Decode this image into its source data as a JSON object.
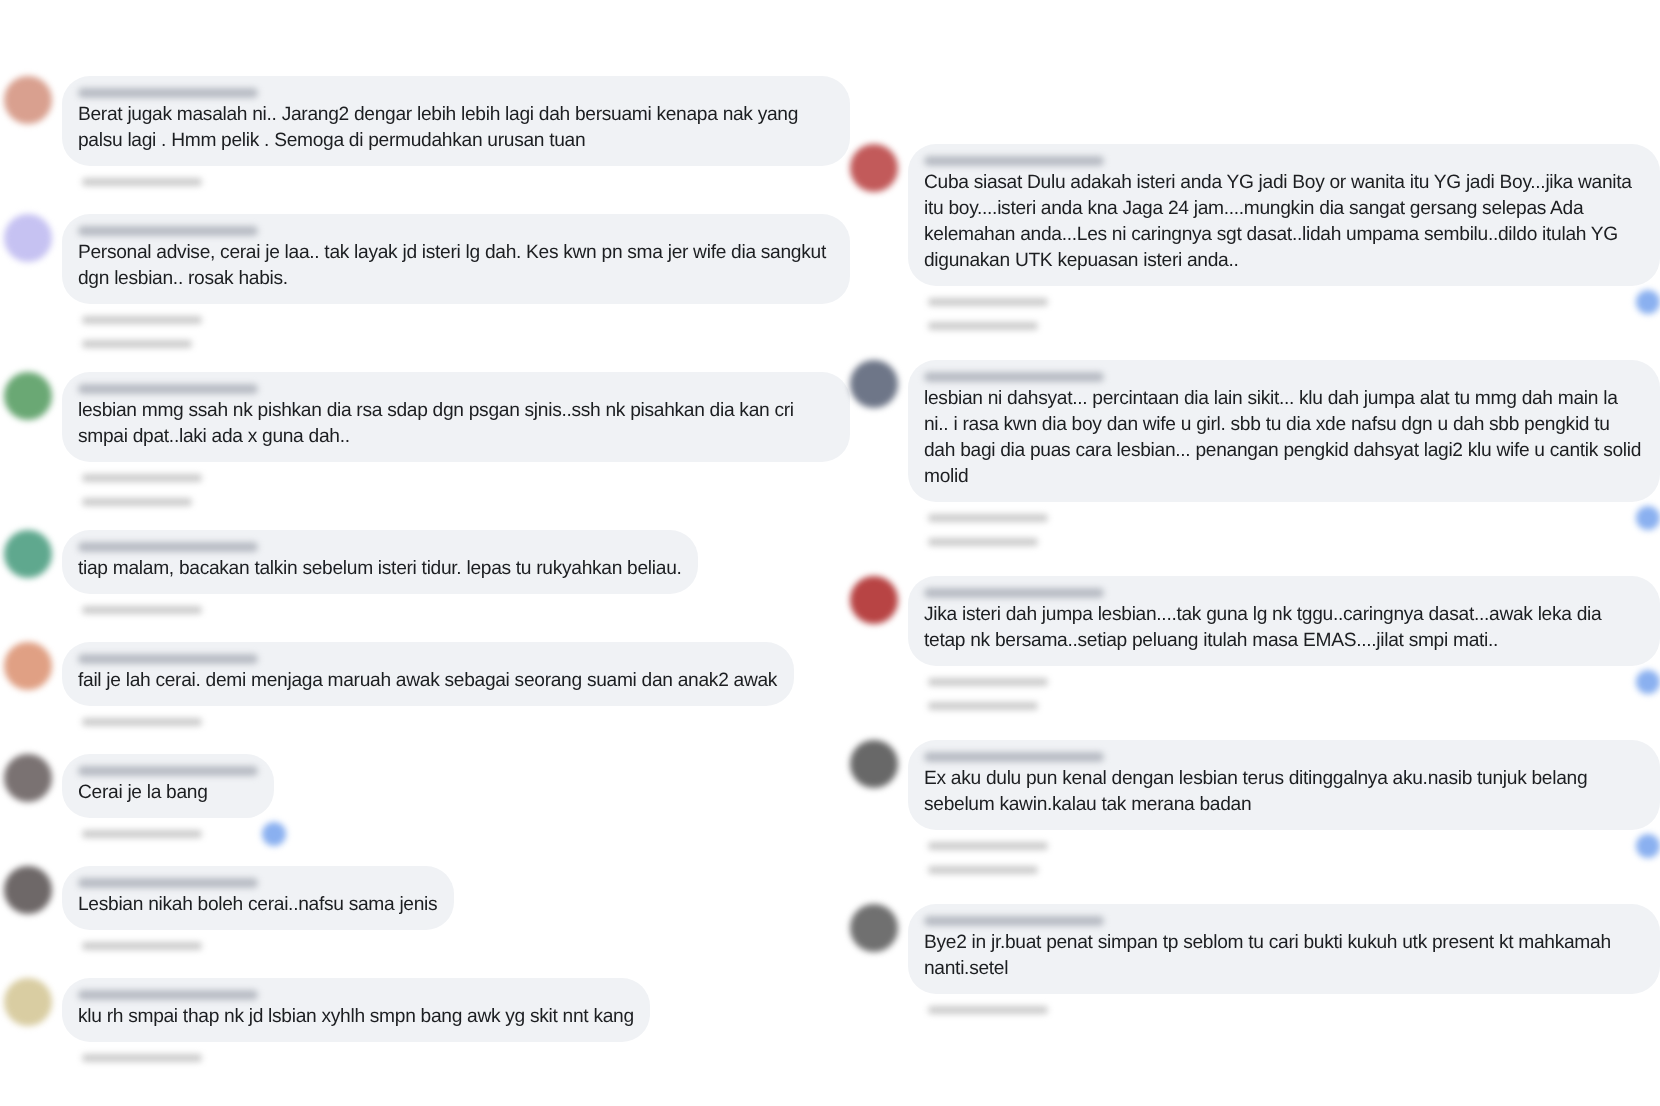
{
  "columns": [
    {
      "comments": [
        {
          "color": "#d9a08f",
          "text": "Berat jugak masalah ni.. Jarang2 dengar lebih lebih lagi dah bersuami kenapa nak yang palsu lagi . Hmm pelik . Semoga di permudahkan urusan tuan",
          "has_replies": false,
          "reacted": false
        },
        {
          "color": "#c6c2f2",
          "text": "Personal advise, cerai je laa.. tak layak jd isteri lg dah. Kes kwn pn sma jer wife dia sangkut dgn lesbian.. rosak habis.",
          "has_replies": true,
          "reacted": false
        },
        {
          "color": "#6aa874",
          "text": "lesbian mmg ssah nk pishkan dia rsa sdap dgn psgan sjnis..ssh nk pisahkan dia kan cri smpai dpat..laki ada x guna dah..",
          "has_replies": true,
          "reacted": false
        },
        {
          "color": "#5fa88e",
          "text": "tiap malam, bacakan talkin sebelum isteri tidur. lepas tu rukyahkan beliau.",
          "has_replies": false,
          "reacted": false
        },
        {
          "color": "#e0a084",
          "text": "fail je lah cerai. demi menjaga maruah awak sebagai seorang suami dan anak2 awak",
          "has_replies": false,
          "reacted": false
        },
        {
          "color": "#7a7272",
          "text": "Cerai je la bang",
          "has_replies": false,
          "reacted": true
        },
        {
          "color": "#6e6868",
          "text": "Lesbian nikah boleh cerai..nafsu sama jenis",
          "has_replies": false,
          "reacted": false
        },
        {
          "color": "#d9cda2",
          "text": "klu rh smpai thap nk jd lsbian xyhlh smpn bang awk yg skit nnt kang",
          "has_replies": false,
          "reacted": false
        }
      ]
    },
    {
      "comments": [
        {
          "color": "#c25a5a",
          "text": "Cuba siasat Dulu adakah isteri anda YG jadi Boy or wanita itu YG jadi Boy...jika wanita itu boy....isteri anda kna Jaga 24 jam....mungkin dia sangat gersang selepas Ada kelemahan anda...Les ni caringnya sgt dasat..lidah umpama sembilu..dildo itulah YG digunakan UTK kepuasan isteri anda..",
          "has_replies": true,
          "reacted": true
        },
        {
          "color": "#6e7688",
          "text": "lesbian ni dahsyat... percintaan dia lain sikit... klu dah jumpa alat tu mmg dah main la ni.. i rasa kwn dia boy dan wife u girl. sbb tu dia xde nafsu dgn u dah sbb pengkid tu dah bagi dia puas cara lesbian... penangan pengkid dahsyat lagi2 klu wife u cantik solid molid",
          "has_replies": true,
          "reacted": true
        },
        {
          "color": "#b84444",
          "text": "Jika isteri dah jumpa lesbian....tak guna lg nk tggu..caringnya dasat...awak leka dia tetap nk bersama..setiap peluang itulah masa EMAS....jilat smpi mati..",
          "has_replies": true,
          "reacted": true
        },
        {
          "color": "#686868",
          "text": "Ex aku dulu pun kenal dengan lesbian terus ditinggalnya aku.nasib tunjuk belang sebelum kawin.kalau tak merana badan",
          "has_replies": true,
          "reacted": true
        },
        {
          "color": "#707070",
          "text": "Bye2 in jr.buat penat simpan tp seblom tu cari bukti kukuh utk present kt mahkamah nanti.setel",
          "has_replies": false,
          "reacted": false
        }
      ]
    }
  ]
}
